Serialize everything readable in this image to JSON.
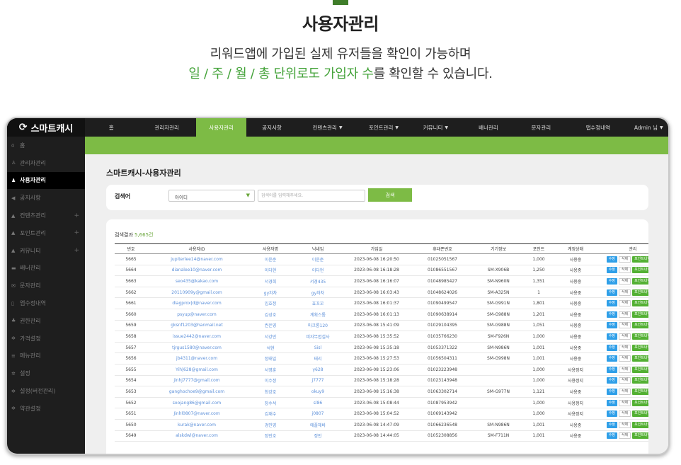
{
  "heading": "사용자관리",
  "description": {
    "line1": "리워드앱에 가입된 실제 유저들을 확인이 가능하며",
    "line2_highlight": "일 / 주 / 월 / 총 단위로도 가입자 수",
    "line2_rest": "를 확인할 수 있습니다."
  },
  "app": {
    "logo_text": "스마트캐시",
    "accent_color": "#7dbb45"
  },
  "sidebar": {
    "items": [
      {
        "icon": "home-icon",
        "glyph": "⌂",
        "label": "홈",
        "plus": ""
      },
      {
        "icon": "admin-icon",
        "glyph": "♙",
        "label": "관리자관리",
        "plus": ""
      },
      {
        "icon": "user-icon",
        "glyph": "♟",
        "label": "사용자관리",
        "plus": "",
        "active": true
      },
      {
        "icon": "megaphone-icon",
        "glyph": "◀",
        "label": "공지사항",
        "plus": ""
      },
      {
        "icon": "content-icon",
        "glyph": "▲",
        "label": "컨텐츠관리",
        "plus": "+"
      },
      {
        "icon": "point-icon",
        "glyph": "▲",
        "label": "포인트관리",
        "plus": "+"
      },
      {
        "icon": "community-icon",
        "glyph": "▲",
        "label": "커뮤니티",
        "plus": "+"
      },
      {
        "icon": "banner-icon",
        "glyph": "▬",
        "label": "배너관리",
        "plus": ""
      },
      {
        "icon": "message-icon",
        "glyph": "✉",
        "label": "문자관리",
        "plus": ""
      },
      {
        "icon": "phone-icon",
        "glyph": "▯",
        "label": "앱수정내역",
        "plus": ""
      },
      {
        "icon": "permission-icon",
        "glyph": "♣",
        "label": "권한관리",
        "plus": ""
      },
      {
        "icon": "price-icon",
        "glyph": "✲",
        "label": "가격설정",
        "plus": ""
      },
      {
        "icon": "menu-icon",
        "glyph": "≡",
        "label": "메뉴관리",
        "plus": ""
      },
      {
        "icon": "settings-icon",
        "glyph": "✲",
        "label": "설정",
        "plus": ""
      },
      {
        "icon": "version-settings-icon",
        "glyph": "✲",
        "label": "설정(버전관리)",
        "plus": ""
      },
      {
        "icon": "terms-icon",
        "glyph": "✲",
        "label": "약관설정",
        "plus": ""
      }
    ]
  },
  "topnav": {
    "items": [
      {
        "label": "홈",
        "caret": ""
      },
      {
        "label": "관리자관리",
        "caret": ""
      },
      {
        "label": "사용자관리",
        "caret": "",
        "active": true
      },
      {
        "label": "공지사항",
        "caret": ""
      },
      {
        "label": "컨텐츠관리",
        "caret": "▼"
      },
      {
        "label": "포인트관리",
        "caret": "▼"
      },
      {
        "label": "커뮤니티",
        "caret": "▼"
      },
      {
        "label": "배너관리",
        "caret": ""
      },
      {
        "label": "문자관리",
        "caret": ""
      },
      {
        "label": "앱수정내역",
        "caret": ""
      },
      {
        "label": "Admin 님",
        "caret": "▼"
      }
    ]
  },
  "main": {
    "title": "스마트캐시-사용자관리",
    "search": {
      "label": "검색어",
      "select_value": "아이디",
      "placeholder": "검색어를 입력해주세요.",
      "button": "검색"
    },
    "result": {
      "label": "검색결과",
      "count": "5,665건"
    },
    "table": {
      "columns": [
        "번호",
        "사용자ID",
        "사용자명",
        "닉네임",
        "가입일",
        "휴대폰번호",
        "기기정보",
        "포인트",
        "계정상태",
        "관리"
      ],
      "action_labels": {
        "edit": "수정",
        "delete": "삭제",
        "points": "포인트내역보기"
      },
      "rows": [
        [
          "5665",
          "jupiterlee14@naver.com",
          "이윤준",
          "이윤준",
          "2023-06-08 16:20:50",
          "01025051567",
          "",
          "1,000",
          "사용중"
        ],
        [
          "5664",
          "dianalee10@naver.com",
          "이다현",
          "이다현",
          "2023-06-08 16:18:28",
          "01086551567",
          "SM-X906B",
          "1,250",
          "사용중"
        ],
        [
          "5663",
          "seo435@kakao.com",
          "서경희",
          "서경435",
          "2023-06-08 16:16:07",
          "01048985427",
          "SM-N960N",
          "1,351",
          "사용중"
        ],
        [
          "5662",
          "20110909y@gmail.com",
          "gy차차",
          "gy차차",
          "2023-06-08 16:03:43",
          "01048624026",
          "SM-A325N",
          "1",
          "사용중"
        ],
        [
          "5661",
          "diagprox|d@naver.com",
          "임효정",
          "효꼬꼬",
          "2023-06-08 16:01:37",
          "01090499547",
          "SM-G991N",
          "1,801",
          "사용중"
        ],
        [
          "5660",
          "psyup@naver.com",
          "김성호",
          "계획스톰",
          "2023-06-08 16:01:13",
          "01090638914",
          "SM-G988N",
          "1,201",
          "사용중"
        ],
        [
          "5659",
          "gksnf1203@hanmail.net",
          "권은영",
          "마크롱120",
          "2023-06-08 15:41:09",
          "01029104395",
          "SM-G988N",
          "1,051",
          "사용중"
        ],
        [
          "5658",
          "issue2442@naver.com",
          "서강민",
          "피자무렵설사",
          "2023-06-08 15:35:52",
          "01035766230",
          "SM-F926N",
          "1,000",
          "사용중"
        ],
        [
          "5657",
          "tjrgus1580@naver.com",
          "석현",
          "Sisl",
          "2023-06-08 15:35:18",
          "01053371322",
          "SM-N986N",
          "1,001",
          "사용중"
        ],
        [
          "5656",
          "jb4311@naver.com",
          "정태일",
          "태리",
          "2023-06-08 15:27:53",
          "01056504311",
          "SM-G998N",
          "1,001",
          "사용중"
        ],
        [
          "5655",
          "Yih|628@gmail.com",
          "서영훈",
          "y628",
          "2023-06-08 15:23:06",
          "01023223948",
          "",
          "1,000",
          "사용정지"
        ],
        [
          "5654",
          "jinhj7777@gmail.com",
          "이수정",
          "j7777",
          "2023-06-08 15:18:28",
          "01023143948",
          "",
          "1,000",
          "사용정지"
        ],
        [
          "5653",
          "ganghochoe9@gmail.com",
          "최강호",
          "okuy9",
          "2023-06-08 15:16:38",
          "01063302714",
          "SM-G977N",
          "1,121",
          "사용중"
        ],
        [
          "5652",
          "soojang86@gmail.com",
          "장수석",
          "sl86",
          "2023-06-08 15:08:44",
          "01087953942",
          "",
          "1,000",
          "사용정지"
        ],
        [
          "5651",
          "Jinhl0807@naver.com",
          "김재수",
          "j0807",
          "2023-06-08 15:04:52",
          "01069143942",
          "",
          "1,000",
          "사용정지"
        ],
        [
          "5650",
          "kurak@naver.com",
          "경민영",
          "애플해바",
          "2023-06-08 14:47:09",
          "01066236548",
          "SM-N986N",
          "1,001",
          "사용중"
        ],
        [
          "5649",
          "alskdwl@naver.com",
          "정민호",
          "정민",
          "2023-06-08 14:44:05",
          "01052308856",
          "SM-F711N",
          "1,001",
          "사용중"
        ]
      ]
    }
  }
}
